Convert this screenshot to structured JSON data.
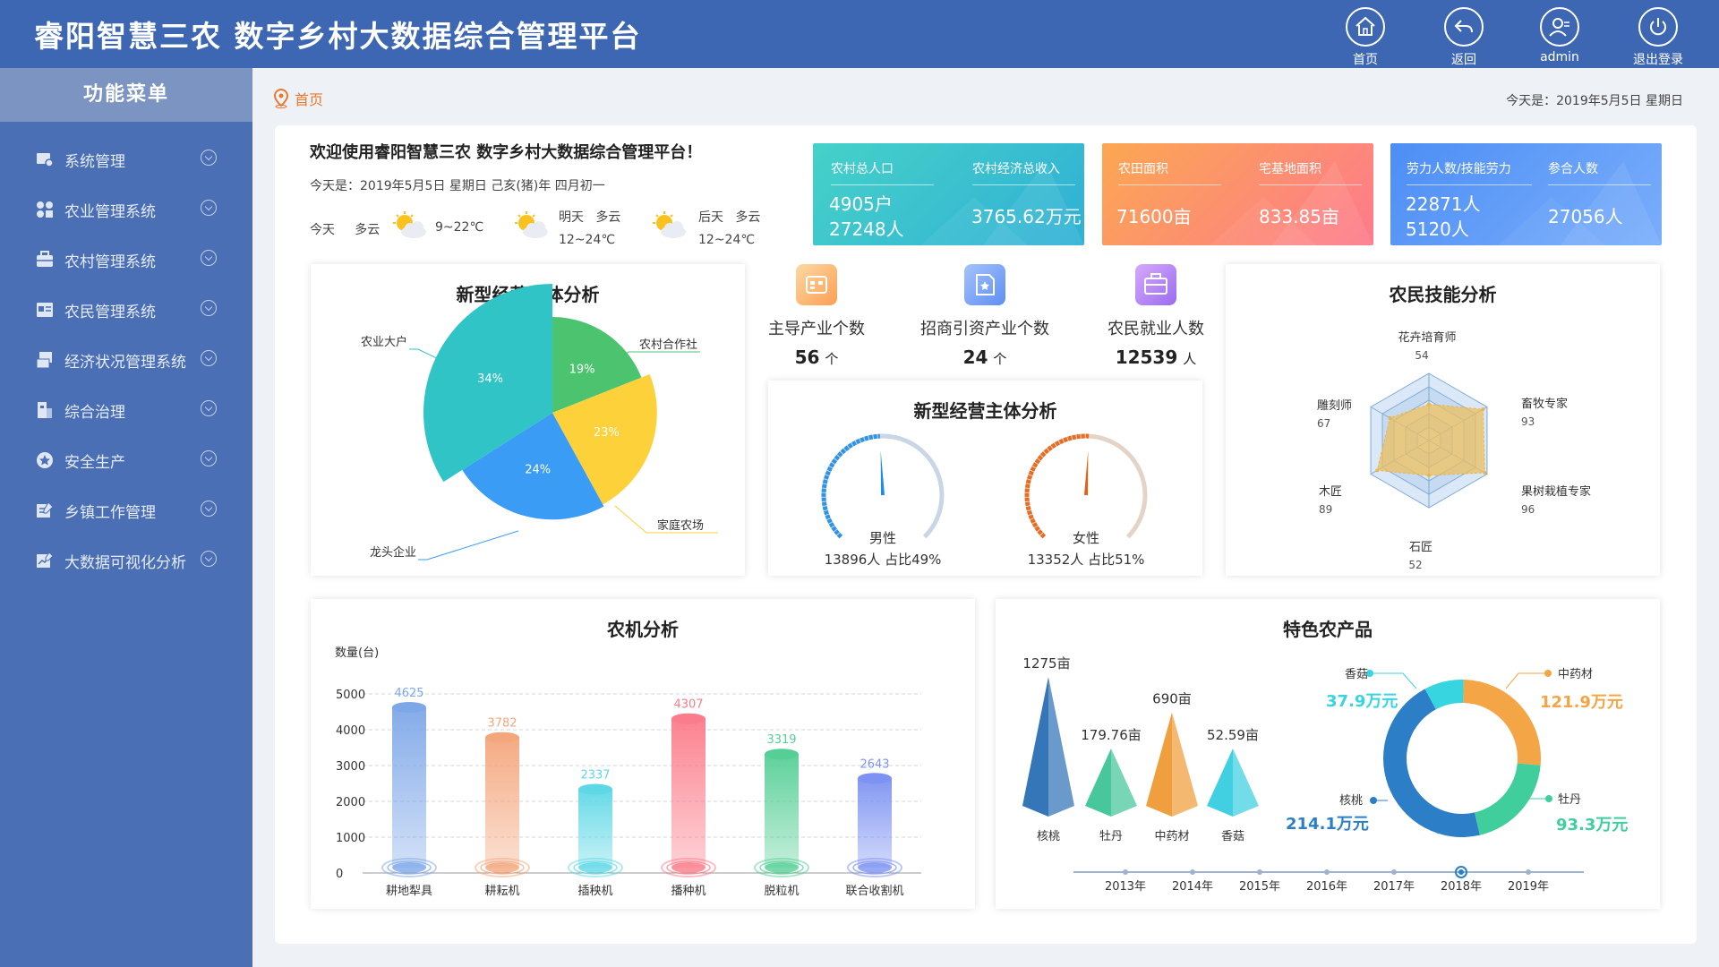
{
  "header": {
    "title": "睿阳智慧三农  数字乡村大数据综合管理平台",
    "buttons": [
      {
        "label": "首页",
        "icon": "home-icon"
      },
      {
        "label": "返回",
        "icon": "back-icon"
      },
      {
        "label": "admin",
        "icon": "user-icon"
      },
      {
        "label": "退出登录",
        "icon": "power-icon"
      }
    ]
  },
  "sidebar": {
    "title": "功能菜单",
    "items": [
      {
        "label": "系统管理",
        "icon": "settings-icon"
      },
      {
        "label": "农业管理系统",
        "icon": "grid-icon"
      },
      {
        "label": "农村管理系统",
        "icon": "briefcase-icon"
      },
      {
        "label": "农民管理系统",
        "icon": "card-icon"
      },
      {
        "label": "经济状况管理系统",
        "icon": "document-icon"
      },
      {
        "label": "综合治理",
        "icon": "building-icon"
      },
      {
        "label": "安全生产",
        "icon": "shield-star-icon"
      },
      {
        "label": "乡镇工作管理",
        "icon": "edit-icon"
      },
      {
        "label": "大数据可视化分析",
        "icon": "chart-edit-icon"
      }
    ]
  },
  "breadcrumb": {
    "label": "首页"
  },
  "today_top": "今天是：2019年5月5日  星期日",
  "welcome": {
    "title": "欢迎使用睿阳智慧三农  数字乡村大数据综合管理平台！",
    "date": "今天是：2019年5月5日   星期日   己亥(猪)年   四月初一",
    "weather": [
      {
        "day": "今天",
        "cond": "多云",
        "temp": "9~22℃"
      },
      {
        "day": "明天",
        "cond": "多云",
        "temp": "12~24℃"
      },
      {
        "day": "后天",
        "cond": "多云",
        "temp": "12~24℃"
      }
    ]
  },
  "stats": [
    {
      "label": "农村总人口",
      "values": [
        "4905户",
        "27248人"
      ]
    },
    {
      "label": "农村经济总收入",
      "values": [
        "3765.62万元"
      ]
    },
    {
      "label": "农田面积",
      "values": [
        "71600亩"
      ]
    },
    {
      "label": "宅基地面积",
      "values": [
        "833.85亩"
      ]
    },
    {
      "label": "劳力人数/技能劳力",
      "values": [
        "22871人",
        "5120人"
      ]
    },
    {
      "label": "参合人数",
      "values": [
        "27056人"
      ]
    }
  ],
  "mini_stats": [
    {
      "label": "主导产业个数",
      "value": "56",
      "unit": "个"
    },
    {
      "label": "招商引资产业个数",
      "value": "24",
      "unit": "个"
    },
    {
      "label": "农民就业人数",
      "value": "12539",
      "unit": "人"
    }
  ],
  "colors": {
    "header": "#3e67b3",
    "sidebar": "#4a6fb4",
    "accent_orange": "#e8792e",
    "teal": "#31c4c6",
    "green": "#4cc36f",
    "yellow": "#fcd13a",
    "blue": "#3a9cf5"
  },
  "chart_data": [
    {
      "type": "pie",
      "variant": "rose",
      "title": "新型经营主体分析",
      "slices": [
        {
          "label": "农业大户",
          "value": 34,
          "color": "#31c4c6"
        },
        {
          "label": "农村合作社",
          "value": 19,
          "color": "#4cc36f"
        },
        {
          "label": "家庭农场",
          "value": 23,
          "color": "#fcd13a"
        },
        {
          "label": "龙头企业",
          "value": 24,
          "color": "#3a9cf5"
        }
      ]
    },
    {
      "type": "gauge",
      "title": "新型经营主体分析",
      "gauges": [
        {
          "label": "男性",
          "value": "13896人",
          "share": "占比49%",
          "percent": 49,
          "color": "#1d8de4"
        },
        {
          "label": "女性",
          "value": "13352人",
          "share": "占比51%",
          "percent": 51,
          "color": "#e8600e"
        }
      ]
    },
    {
      "type": "radar",
      "title": "农民技能分析",
      "indicators": [
        {
          "label": "花卉培育师",
          "value": 54
        },
        {
          "label": "畜牧专家",
          "value": 93
        },
        {
          "label": "果树栽植专家",
          "value": 96
        },
        {
          "label": "石匠",
          "value": 52
        },
        {
          "label": "木匠",
          "value": 89
        },
        {
          "label": "雕刻师",
          "value": 67
        }
      ],
      "max": 100
    },
    {
      "type": "bar",
      "title": "农机分析",
      "ylabel": "数量(台)",
      "ylim": [
        0,
        5000
      ],
      "yticks": [
        0,
        1000,
        2000,
        3000,
        4000,
        5000
      ],
      "categories": [
        "耕地犁具",
        "耕耘机",
        "插秧机",
        "播种机",
        "脱粒机",
        "联合收割机"
      ],
      "values": [
        4625,
        3782,
        2337,
        4307,
        3319,
        2643
      ],
      "colors": [
        "#7ea7e8",
        "#f4a67d",
        "#5fd8e6",
        "#fb7c8a",
        "#56cf96",
        "#7d92f2"
      ]
    },
    {
      "type": "pictorial_bar",
      "title": "特色农产品",
      "categories": [
        "核桃",
        "牡丹",
        "中药材",
        "香菇"
      ],
      "labels": [
        "1275亩",
        "179.76亩",
        "690亩",
        "52.59亩"
      ],
      "values": [
        1275,
        179.76,
        690,
        52.59
      ],
      "colors": [
        "#2a6fb5",
        "#3fc497",
        "#ef9a35",
        "#36cde0"
      ]
    },
    {
      "type": "donut",
      "slices": [
        {
          "label": "香菇",
          "value": 37.9,
          "text": "37.9万元",
          "color": "#36d5e0"
        },
        {
          "label": "中药材",
          "value": 121.9,
          "text": "121.9万元",
          "color": "#f4a545"
        },
        {
          "label": "牡丹",
          "value": 93.3,
          "text": "93.3万元",
          "color": "#3fce9c"
        },
        {
          "label": "核桃",
          "value": 214.1,
          "text": "214.1万元",
          "color": "#2c7fc6"
        }
      ]
    },
    {
      "type": "timeline",
      "years": [
        "2013年",
        "2014年",
        "2015年",
        "2016年",
        "2017年",
        "2018年",
        "2019年"
      ],
      "active": "2018年"
    }
  ]
}
